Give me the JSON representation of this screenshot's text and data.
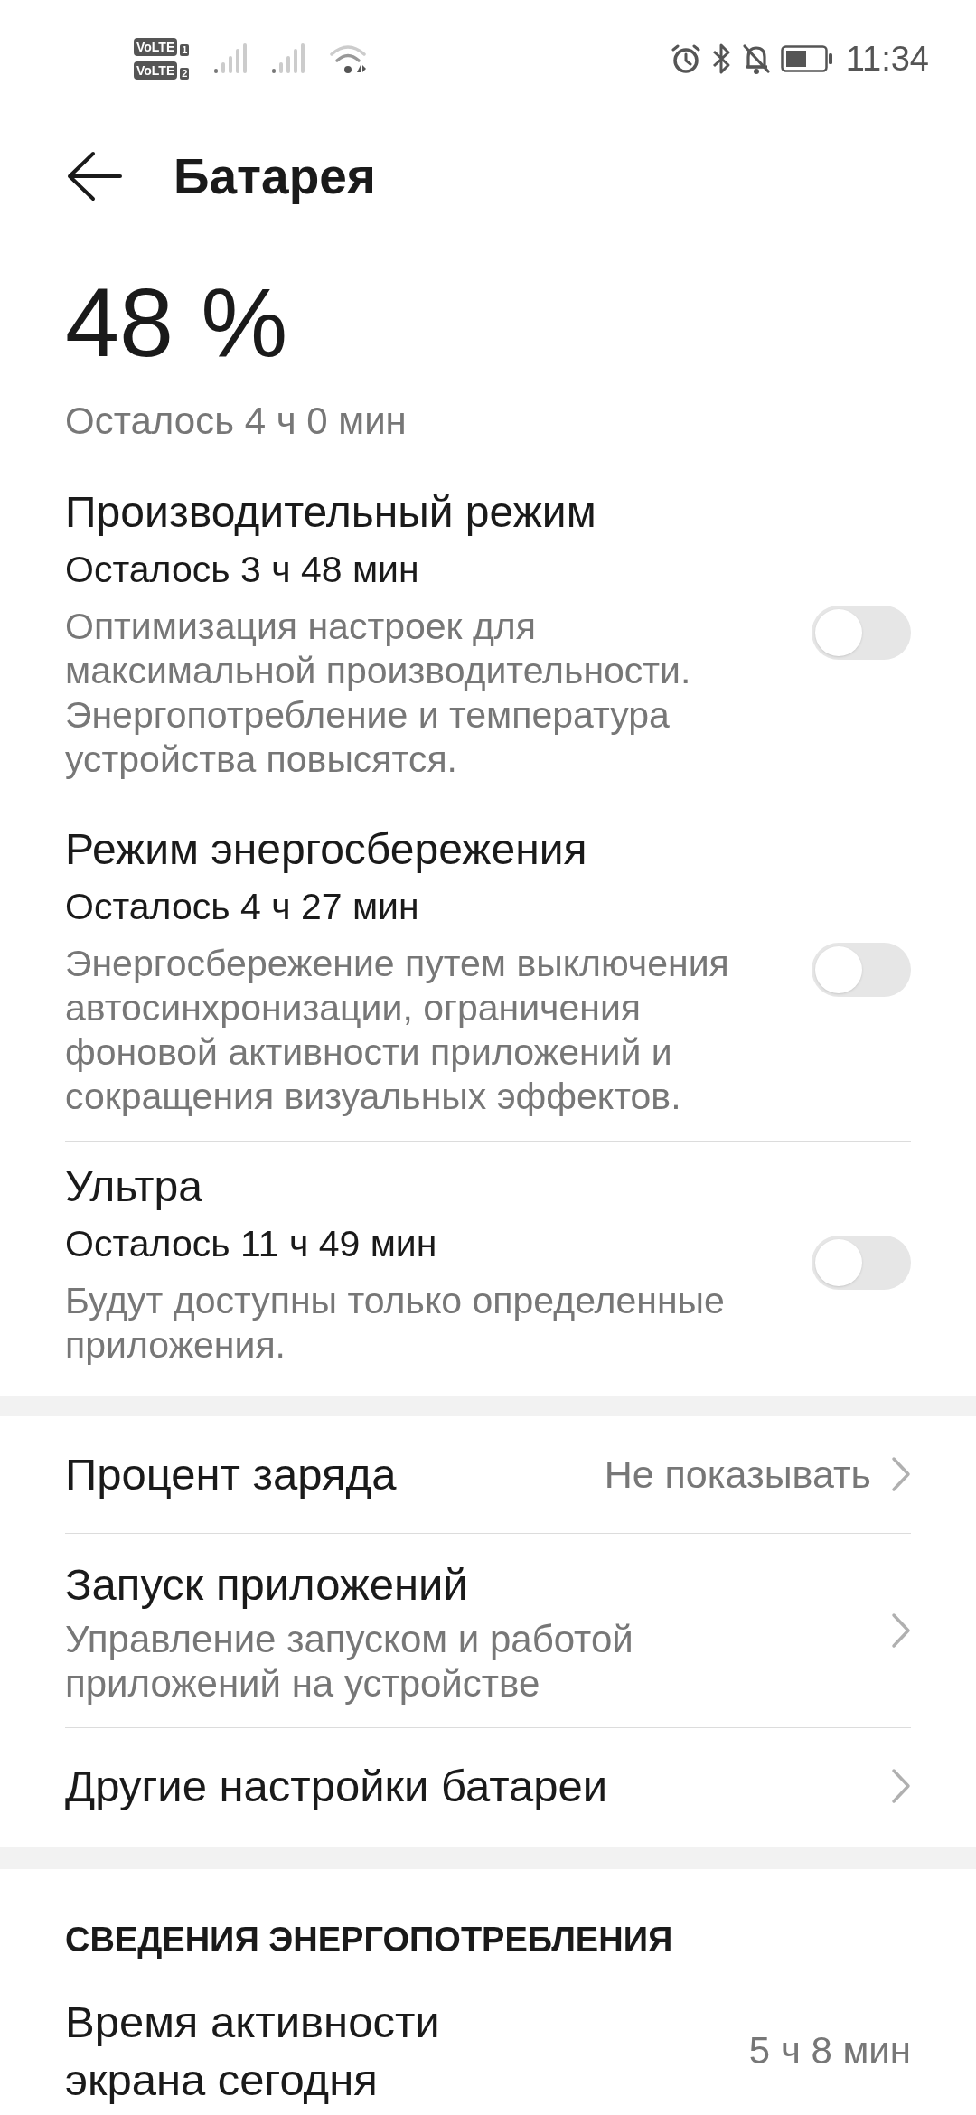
{
  "status_bar": {
    "sims": [
      {
        "label": "VoLTE",
        "slot": "1"
      },
      {
        "label": "VoLTE",
        "slot": "2"
      }
    ],
    "time": "11:34"
  },
  "header": {
    "title": "Батарея"
  },
  "battery": {
    "percent": "48 %",
    "remaining": "Осталось 4 ч 0 мин"
  },
  "modes": [
    {
      "title": "Производительный режим",
      "remaining": "Осталось 3 ч 48 мин",
      "description": "Оптимизация настроек для максимальной производительности. Энергопотребление и температура устройства повысятся.",
      "on": false
    },
    {
      "title": "Режим энергосбережения",
      "remaining": "Осталось 4 ч 27 мин",
      "description": "Энергосбережение путем выключения автосинхронизации, ограничения фоновой активности приложений и сокращения визуальных эффектов.",
      "on": false
    },
    {
      "title": "Ультра",
      "remaining": "Осталось 11 ч 49 мин",
      "description": "Будут доступны только определенные приложения.",
      "on": false
    }
  ],
  "settings": [
    {
      "title": "Процент заряда",
      "value": "Не показывать"
    },
    {
      "title": "Запуск приложений",
      "description": "Управление запуском и работой приложений на устройстве"
    },
    {
      "title": "Другие настройки батареи"
    }
  ],
  "usage": {
    "heading": "СВЕДЕНИЯ ЭНЕРГОПОТРЕБЛЕНИЯ",
    "rows": [
      {
        "title": "Время активности экрана сегодня",
        "value": "5 ч 8 мин"
      }
    ]
  }
}
